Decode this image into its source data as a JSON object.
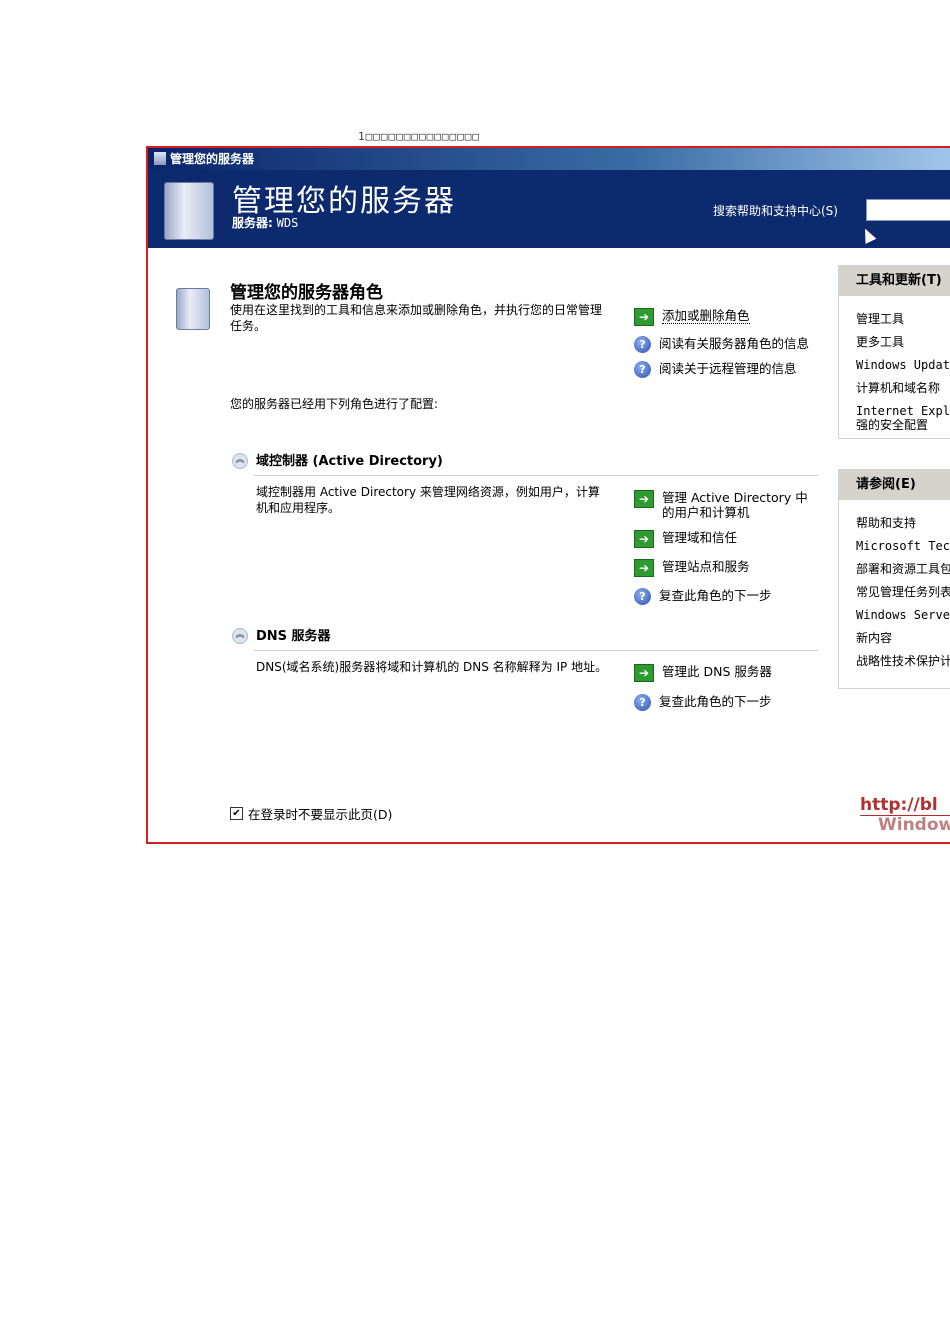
{
  "caption": "1□□□□□□□□□□□□□□□",
  "window": {
    "title": "管理您的服务器"
  },
  "header": {
    "title": "管理您的服务器",
    "server_label": "服务器:",
    "server_name": "WDS",
    "search_label": "搜索帮助和支持中心(S)",
    "search_value": ""
  },
  "main": {
    "title": "管理您的服务器角色",
    "description": "使用在这里找到的工具和信息来添加或删除角色，并执行您的日常管理任务。",
    "configured_text": "您的服务器已经用下列角色进行了配置:",
    "top_links": [
      {
        "icon": "arrow-icon",
        "label": "添加或删除角色"
      },
      {
        "icon": "help-icon",
        "label": "阅读有关服务器角色的信息"
      },
      {
        "icon": "help-icon",
        "label": "阅读关于远程管理的信息"
      }
    ],
    "roles": [
      {
        "title": "域控制器 (Active Directory)",
        "description": "域控制器用 Active Directory 来管理网络资源，例如用户，计算机和应用程序。",
        "links": [
          {
            "icon": "arrow-icon",
            "label": "管理 Active Directory 中的用户和计算机"
          },
          {
            "icon": "arrow-icon",
            "label": "管理域和信任"
          },
          {
            "icon": "arrow-icon",
            "label": "管理站点和服务"
          },
          {
            "icon": "help-icon",
            "label": "复查此角色的下一步"
          }
        ]
      },
      {
        "title": "DNS 服务器",
        "description": "DNS(域名系统)服务器将域和计算机的 DNS 名称解释为 IP 地址。",
        "links": [
          {
            "icon": "arrow-icon",
            "label": "管理此 DNS 服务器"
          },
          {
            "icon": "help-icon",
            "label": "复查此角色的下一步"
          }
        ]
      }
    ],
    "checkbox_label": "在登录时不要显示此页(D)",
    "checkbox_checked": true
  },
  "tools_panel": {
    "title": "工具和更新(T)",
    "items": [
      "管理工具",
      "更多工具",
      "Windows Update",
      "计算机和域名称",
      "Internet Explorer 增强的安全配置"
    ]
  },
  "see_also_panel": {
    "title": "请参阅(E)",
    "items": [
      "帮助和支持",
      "Microsoft TechNet",
      "部署和资源工具包",
      "常见管理任务列表",
      "Windows Server Communities",
      "新内容",
      "战略性技术保护计划"
    ]
  },
  "watermark": [
    "http://bl",
    "Window"
  ]
}
